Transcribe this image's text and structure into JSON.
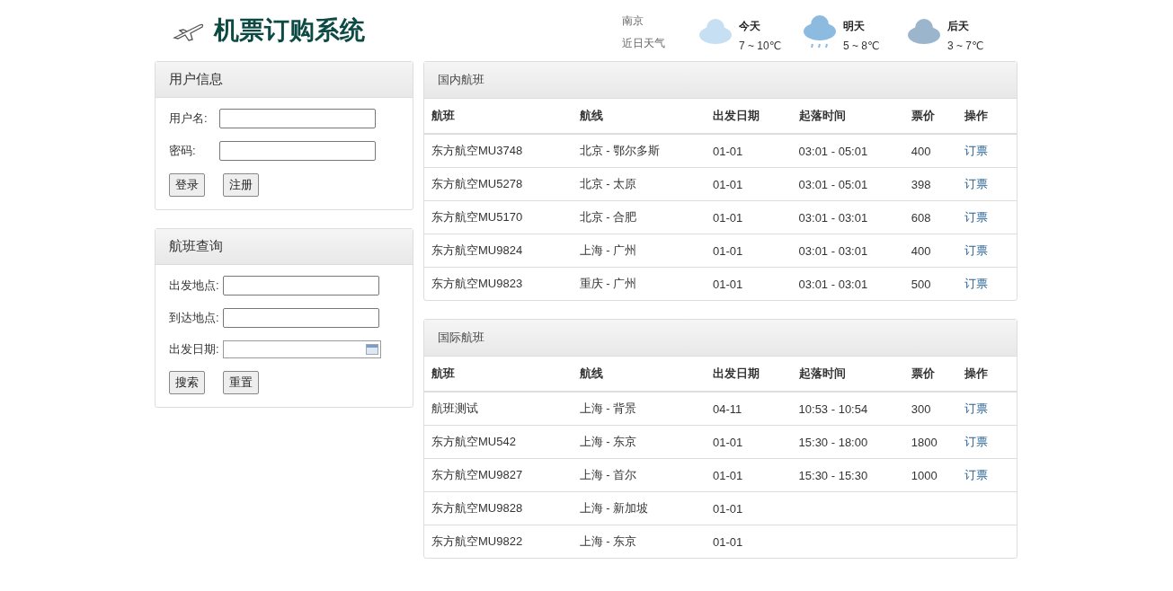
{
  "header": {
    "title": "机票订购系统",
    "weather": {
      "city": "南京",
      "caption": "近日天气",
      "days": [
        {
          "label": "今天",
          "range": "7 ~ 10℃",
          "kind": "cloudy-light"
        },
        {
          "label": "明天",
          "range": "5 ~ 8℃",
          "kind": "rain"
        },
        {
          "label": "后天",
          "range": "3 ~ 7℃",
          "kind": "cloudy"
        }
      ]
    }
  },
  "user_panel": {
    "title": "用户信息",
    "fields": [
      {
        "label": "用户名:",
        "kind": "input"
      },
      {
        "label": "密码:",
        "kind": "input"
      }
    ],
    "buttons": [
      "登录",
      "注册"
    ]
  },
  "search_panel": {
    "title": "航班查询",
    "fields": [
      {
        "label": "出发地点:",
        "kind": "input"
      },
      {
        "label": "到达地点:",
        "kind": "input"
      },
      {
        "label": "出发日期:",
        "kind": "date"
      }
    ],
    "buttons": [
      "搜索",
      "重置"
    ]
  },
  "tables": [
    {
      "title": "国内航班",
      "columns": [
        "航班",
        "航线",
        "出发日期",
        "起落时间",
        "票价",
        "操作"
      ],
      "rows": [
        {
          "flight": "东方航空MU3748",
          "route": "北京 - 鄂尔多斯",
          "date": "01-01",
          "time": "03:01 - 05:01",
          "price": "400",
          "action": "订票"
        },
        {
          "flight": "东方航空MU5278",
          "route": "北京 - 太原",
          "date": "01-01",
          "time": "03:01 - 05:01",
          "price": "398",
          "action": "订票"
        },
        {
          "flight": "东方航空MU5170",
          "route": "北京 - 合肥",
          "date": "01-01",
          "time": "03:01 - 03:01",
          "price": "608",
          "action": "订票"
        },
        {
          "flight": "东方航空MU9824",
          "route": "上海 - 广州",
          "date": "01-01",
          "time": "03:01 - 03:01",
          "price": "400",
          "action": "订票"
        },
        {
          "flight": "东方航空MU9823",
          "route": "重庆 - 广州",
          "date": "01-01",
          "time": "03:01 - 03:01",
          "price": "500",
          "action": "订票"
        }
      ]
    },
    {
      "title": "国际航班",
      "columns": [
        "航班",
        "航线",
        "出发日期",
        "起落时间",
        "票价",
        "操作"
      ],
      "rows": [
        {
          "flight": "航班测试",
          "route": "上海 - 背景",
          "date": "04-11",
          "time": "10:53 - 10:54",
          "price": "300",
          "action": "订票"
        },
        {
          "flight": "东方航空MU542",
          "route": "上海 - 东京",
          "date": "01-01",
          "time": "15:30 - 18:00",
          "price": "1800",
          "action": "订票"
        },
        {
          "flight": "东方航空MU9827",
          "route": "上海 - 首尔",
          "date": "01-01",
          "time": "15:30 - 15:30",
          "price": "1000",
          "action": "订票"
        },
        {
          "flight": "东方航空MU9828",
          "route": "上海 - 新加坡",
          "date": "01-01"
        },
        {
          "flight": "东方航空MU9822",
          "route": "上海 - 东京",
          "date": "01-01"
        }
      ]
    }
  ]
}
